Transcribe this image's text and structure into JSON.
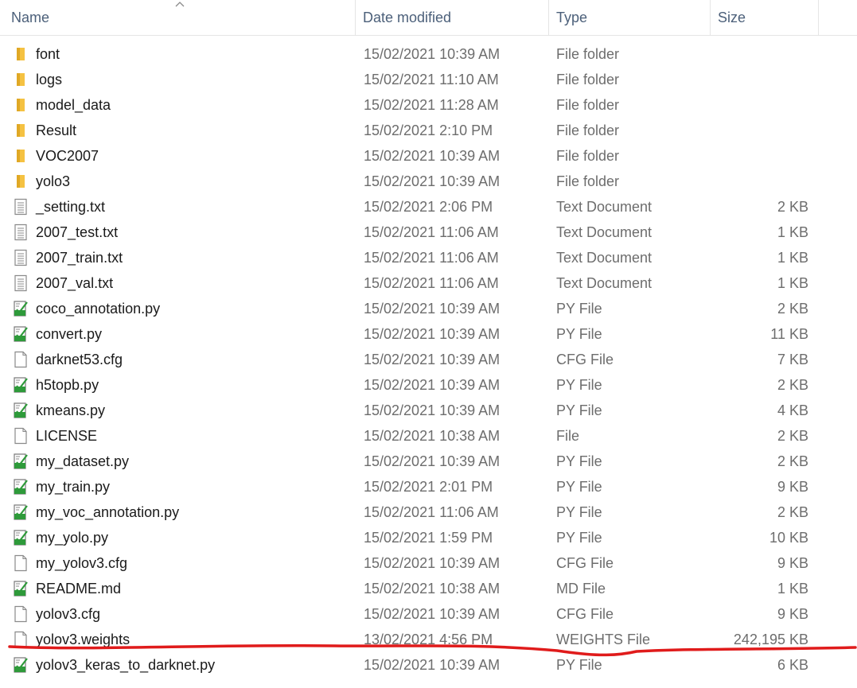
{
  "columns": {
    "name": "Name",
    "date": "Date modified",
    "type": "Type",
    "size": "Size"
  },
  "files": [
    {
      "name": "font",
      "date": "15/02/2021 10:39 AM",
      "type": "File folder",
      "size": "",
      "icon": "folder-icon"
    },
    {
      "name": "logs",
      "date": "15/02/2021 11:10 AM",
      "type": "File folder",
      "size": "",
      "icon": "folder-icon"
    },
    {
      "name": "model_data",
      "date": "15/02/2021 11:28 AM",
      "type": "File folder",
      "size": "",
      "icon": "folder-icon"
    },
    {
      "name": "Result",
      "date": "15/02/2021 2:10 PM",
      "type": "File folder",
      "size": "",
      "icon": "folder-icon"
    },
    {
      "name": "VOC2007",
      "date": "15/02/2021 10:39 AM",
      "type": "File folder",
      "size": "",
      "icon": "folder-icon"
    },
    {
      "name": "yolo3",
      "date": "15/02/2021 10:39 AM",
      "type": "File folder",
      "size": "",
      "icon": "folder-icon"
    },
    {
      "name": "_setting.txt",
      "date": "15/02/2021 2:06 PM",
      "type": "Text Document",
      "size": "2 KB",
      "icon": "text-file-icon"
    },
    {
      "name": "2007_test.txt",
      "date": "15/02/2021 11:06 AM",
      "type": "Text Document",
      "size": "1 KB",
      "icon": "text-file-icon"
    },
    {
      "name": "2007_train.txt",
      "date": "15/02/2021 11:06 AM",
      "type": "Text Document",
      "size": "1 KB",
      "icon": "text-file-icon"
    },
    {
      "name": "2007_val.txt",
      "date": "15/02/2021 11:06 AM",
      "type": "Text Document",
      "size": "1 KB",
      "icon": "text-file-icon"
    },
    {
      "name": "coco_annotation.py",
      "date": "15/02/2021 10:39 AM",
      "type": "PY File",
      "size": "2 KB",
      "icon": "python-file-icon"
    },
    {
      "name": "convert.py",
      "date": "15/02/2021 10:39 AM",
      "type": "PY File",
      "size": "11 KB",
      "icon": "python-file-icon"
    },
    {
      "name": "darknet53.cfg",
      "date": "15/02/2021 10:39 AM",
      "type": "CFG File",
      "size": "7 KB",
      "icon": "blank-file-icon"
    },
    {
      "name": "h5topb.py",
      "date": "15/02/2021 10:39 AM",
      "type": "PY File",
      "size": "2 KB",
      "icon": "python-file-icon"
    },
    {
      "name": "kmeans.py",
      "date": "15/02/2021 10:39 AM",
      "type": "PY File",
      "size": "4 KB",
      "icon": "python-file-icon"
    },
    {
      "name": "LICENSE",
      "date": "15/02/2021 10:38 AM",
      "type": "File",
      "size": "2 KB",
      "icon": "blank-file-icon"
    },
    {
      "name": "my_dataset.py",
      "date": "15/02/2021 10:39 AM",
      "type": "PY File",
      "size": "2 KB",
      "icon": "python-file-icon"
    },
    {
      "name": "my_train.py",
      "date": "15/02/2021 2:01 PM",
      "type": "PY File",
      "size": "9 KB",
      "icon": "python-file-icon"
    },
    {
      "name": "my_voc_annotation.py",
      "date": "15/02/2021 11:06 AM",
      "type": "PY File",
      "size": "2 KB",
      "icon": "python-file-icon"
    },
    {
      "name": "my_yolo.py",
      "date": "15/02/2021 1:59 PM",
      "type": "PY File",
      "size": "10 KB",
      "icon": "python-file-icon"
    },
    {
      "name": "my_yolov3.cfg",
      "date": "15/02/2021 10:39 AM",
      "type": "CFG File",
      "size": "9 KB",
      "icon": "blank-file-icon"
    },
    {
      "name": "README.md",
      "date": "15/02/2021 10:38 AM",
      "type": "MD File",
      "size": "1 KB",
      "icon": "python-file-icon"
    },
    {
      "name": "yolov3.cfg",
      "date": "15/02/2021 10:39 AM",
      "type": "CFG File",
      "size": "9 KB",
      "icon": "blank-file-icon"
    },
    {
      "name": "yolov3.weights",
      "date": "13/02/2021 4:56 PM",
      "type": "WEIGHTS File",
      "size": "242,195 KB",
      "icon": "blank-file-icon"
    },
    {
      "name": "yolov3_keras_to_darknet.py",
      "date": "15/02/2021 10:39 AM",
      "type": "PY File",
      "size": "6 KB",
      "icon": "python-file-icon"
    }
  ],
  "colors": {
    "header_text": "#4c607a",
    "folder": "#f5c242",
    "annotation_line": "#e01b1b"
  }
}
